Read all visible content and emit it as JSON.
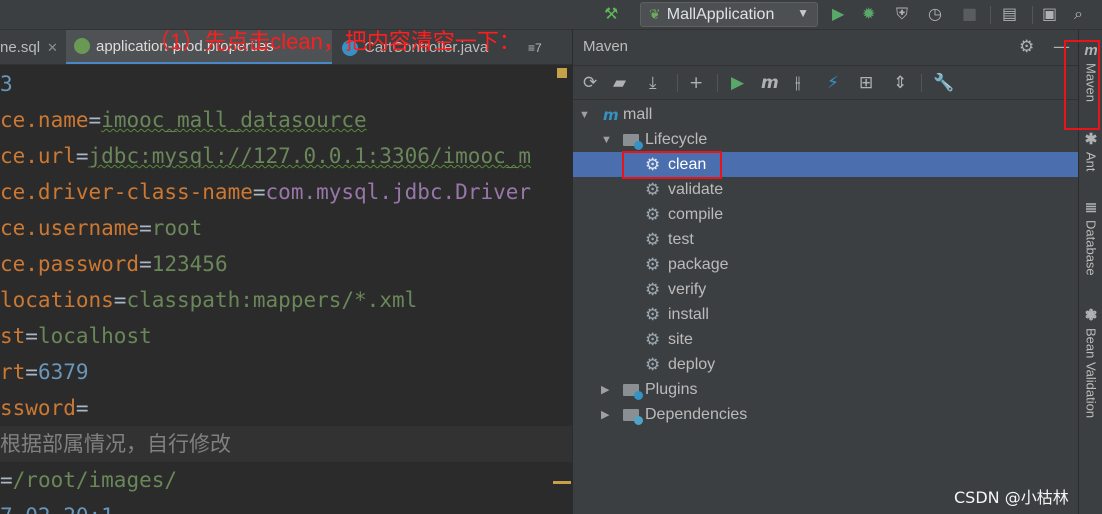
{
  "toolbar": {
    "run_config": "MallApplication"
  },
  "tabs": [
    {
      "label": "ne.sql"
    },
    {
      "label": "application-prod.properties"
    },
    {
      "label": "CartController.java"
    },
    {
      "label": "≡7"
    }
  ],
  "annotation": "（1）先点击clean，把内容清空一下：",
  "editor": {
    "lines": [
      {
        "prefix": "3",
        "key": "",
        "value": ""
      },
      {
        "prefix": "ce.name",
        "value": "imooc_mall_datasource"
      },
      {
        "prefix": "ce.url",
        "value": "jdbc:mysql://127.0.0.1:3306/imooc_m"
      },
      {
        "prefix": "ce.driver-class-name",
        "value": "com.mysql.jdbc.Driver"
      },
      {
        "prefix": "ce.username",
        "value": "root"
      },
      {
        "prefix": "ce.password",
        "value": "123456"
      },
      {
        "prefix": "locations",
        "value": "classpath:mappers/*.xml"
      },
      {
        "prefix": "st",
        "value": "localhost"
      },
      {
        "prefix": "rt",
        "value": "6379"
      },
      {
        "prefix": "ssword",
        "value": ""
      },
      {
        "comment": "根据部属情况，自行修改"
      },
      {
        "prefix": "",
        "value": "/root/images/"
      },
      {
        "prefix": "",
        "value": "7.02.20:1"
      }
    ]
  },
  "maven": {
    "title": "Maven",
    "tree": {
      "root": "mall",
      "lifecycle": "Lifecycle",
      "goals": [
        "clean",
        "validate",
        "compile",
        "test",
        "package",
        "verify",
        "install",
        "site",
        "deploy"
      ],
      "selected": "clean",
      "plugins": "Plugins",
      "dependencies": "Dependencies"
    }
  },
  "sidebar": {
    "maven": "Maven",
    "ant": "Ant",
    "database": "Database",
    "bean_validation": "Bean Validation"
  },
  "watermark": "CSDN @小枯林",
  "colors": {
    "selection": "#4b6eaf",
    "highlight_box": "#e8141a",
    "annotation": "#ff1e1e"
  }
}
